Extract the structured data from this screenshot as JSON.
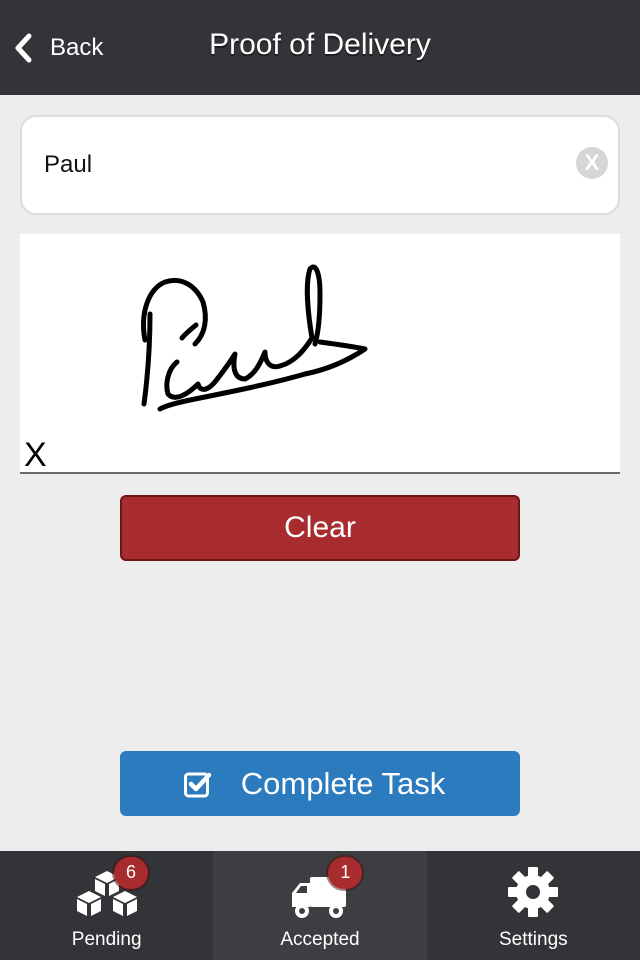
{
  "header": {
    "back_label": "Back",
    "title": "Proof of Delivery"
  },
  "name_field": {
    "value": "Paul",
    "clear_icon": "X"
  },
  "signature": {
    "x_marker": "X"
  },
  "buttons": {
    "clear_label": "Clear",
    "complete_label": "Complete Task"
  },
  "tabbar": {
    "tabs": [
      {
        "label": "Pending",
        "icon": "cubes-icon",
        "badge": "6",
        "active": false
      },
      {
        "label": "Accepted",
        "icon": "truck-icon",
        "badge": "1",
        "active": true
      },
      {
        "label": "Settings",
        "icon": "gear-icon",
        "badge": null,
        "active": false
      }
    ]
  },
  "colors": {
    "header_bg": "#333438",
    "clear_button": "#a82b2e",
    "complete_button": "#2c7bbf",
    "badge": "#a82b2e"
  }
}
